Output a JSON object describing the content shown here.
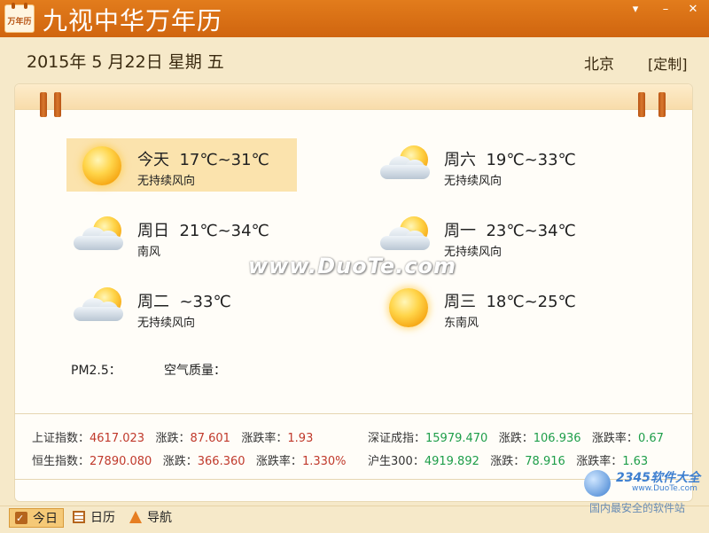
{
  "window": {
    "app_icon_text": "万年历",
    "title": "九视中华万年历",
    "buttons": [
      "▾",
      "–",
      "✕"
    ]
  },
  "header": {
    "date": "2015年 5 月22日 星期 五",
    "city": "北京",
    "customize": "[定制]"
  },
  "forecast": [
    {
      "day": "今天",
      "temp": "17℃~31℃",
      "wind": "无持续风向",
      "icon": "sunny",
      "selected": true
    },
    {
      "day": "周六",
      "temp": "19℃~33℃",
      "wind": "无持续风向",
      "icon": "partly-cloudy"
    },
    {
      "day": "周日",
      "temp": "21℃~34℃",
      "wind": "南风",
      "icon": "partly-cloudy"
    },
    {
      "day": "周一",
      "temp": "23℃~34℃",
      "wind": "无持续风向",
      "icon": "partly-cloudy"
    },
    {
      "day": "周二",
      "temp": "~33℃",
      "wind": "无持续风向",
      "icon": "partly-cloudy"
    },
    {
      "day": "周三",
      "temp": "18℃~25℃",
      "wind": "东南风",
      "icon": "sunny"
    }
  ],
  "watermark": "www.DuoTe.com",
  "air": {
    "pm25_label": "PM2.5：",
    "quality_label": "空气质量："
  },
  "stocks": [
    {
      "name": "上证指数：",
      "value": "4617.023",
      "change_label": "涨跌：",
      "change": "87.601",
      "rate_label": "涨跌率：",
      "rate": "1.93",
      "color": "red"
    },
    {
      "name": "深证成指：",
      "value": "15979.470",
      "change_label": "涨跌：",
      "change": "106.936",
      "rate_label": "涨跌率：",
      "rate": "0.67",
      "color": "green"
    },
    {
      "name": "恒生指数：",
      "value": "27890.080",
      "change_label": "涨跌：",
      "change": "366.360",
      "rate_label": "涨跌率：",
      "rate": "1.330%",
      "color": "red"
    },
    {
      "name": "沪生300：",
      "value": "4919.892",
      "change_label": "涨跌：",
      "change": "78.916",
      "rate_label": "涨跌率：",
      "rate": "1.63",
      "color": "green"
    }
  ],
  "footer_tabs": [
    {
      "label": "今日",
      "icon": "today-icon",
      "active": true
    },
    {
      "label": "日历",
      "icon": "calendar-icon"
    },
    {
      "label": "导航",
      "icon": "navigation-icon"
    }
  ],
  "brand": {
    "logo": "2345软件大全",
    "url": "www.DuoTe.com",
    "slogan": "国内最安全的软件站"
  },
  "colors": {
    "titlebar": "#d9711a",
    "background": "#f6e9c9",
    "up": "#c0392b",
    "down": "#1e9e4a"
  }
}
